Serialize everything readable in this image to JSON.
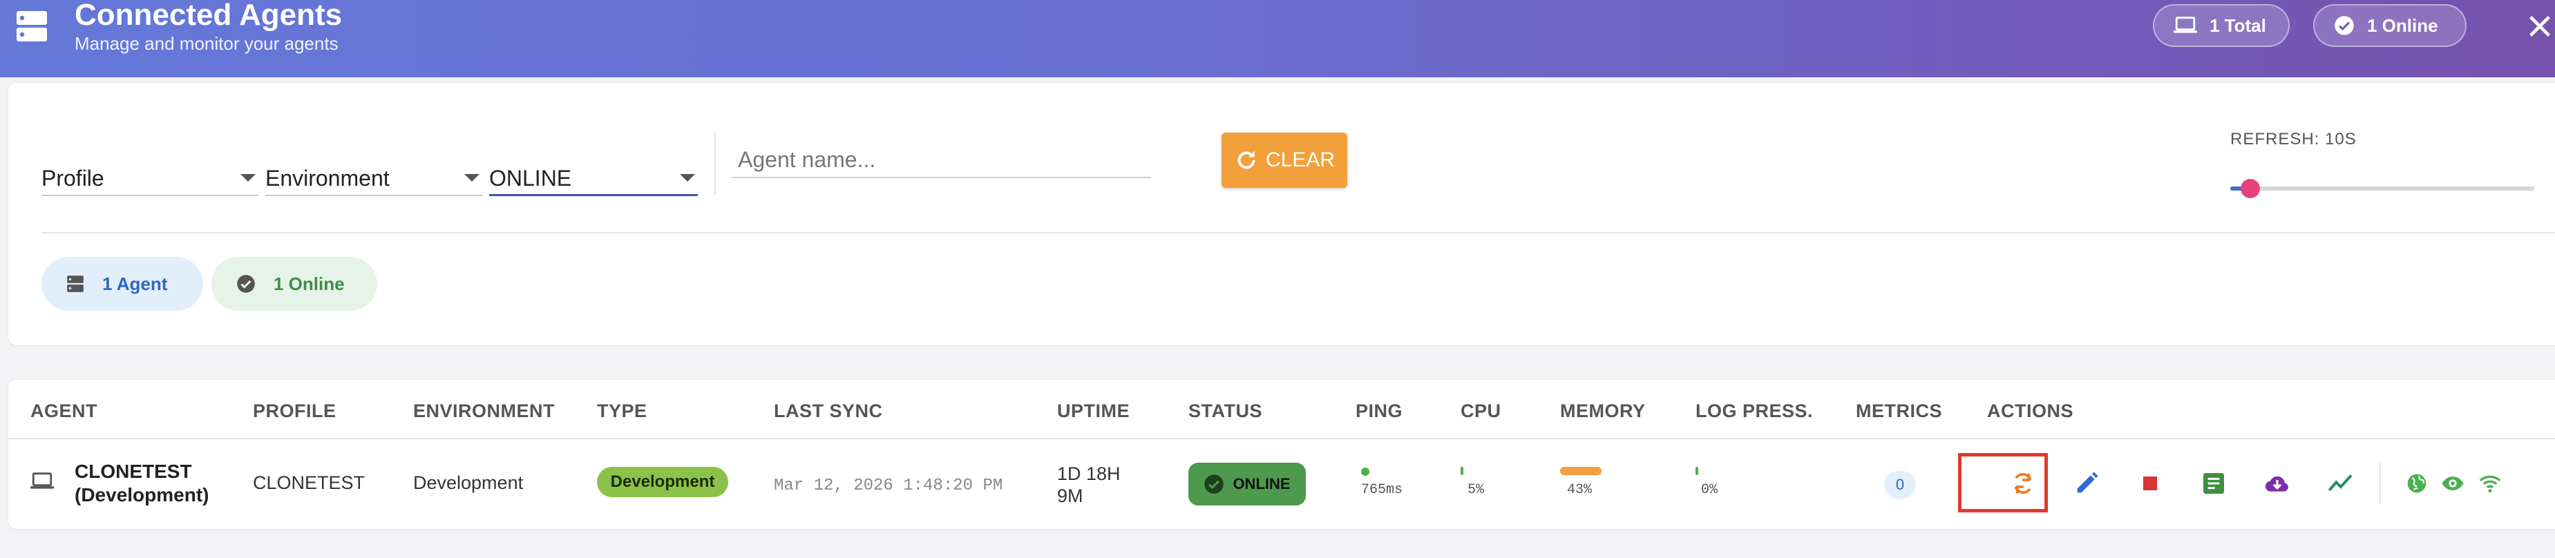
{
  "header": {
    "title": "Connected Agents",
    "subtitle": "Manage and monitor your agents",
    "total_chip": "1 Total",
    "online_chip": "1 Online"
  },
  "filters": {
    "profile_label": "Profile",
    "environment_label": "Environment",
    "status_value": "ONLINE",
    "agent_name_placeholder": "Agent name...",
    "clear_label": "CLEAR",
    "refresh_label": "REFRESH: 10S",
    "refresh_slider_fraction": 0.065,
    "agents_pill": "1 Agent",
    "online_pill": "1 Online"
  },
  "table": {
    "columns": [
      "AGENT",
      "PROFILE",
      "ENVIRONMENT",
      "TYPE",
      "LAST SYNC",
      "UPTIME",
      "STATUS",
      "PING",
      "CPU",
      "MEMORY",
      "LOG PRESS.",
      "METRICS",
      "ACTIONS"
    ],
    "row": {
      "agent_line1": "CLONETEST",
      "agent_line2": "(Development)",
      "profile": "CLONETEST",
      "environment": "Development",
      "type": "Development",
      "last_sync": "Mar 12, 2026 1:48:20 PM",
      "uptime_line1": "1D 18H",
      "uptime_line2": "9M",
      "status": "ONLINE",
      "ping": "765ms",
      "cpu": "5%",
      "cpu_fraction": 0.05,
      "memory": "43%",
      "memory_fraction": 0.43,
      "log_pressure": "0%",
      "log_pressure_fraction": 0.0,
      "metrics": "0"
    }
  },
  "colors": {
    "header_start": "#6478d8",
    "header_end": "#7651ad",
    "accent_blue": "#3f51b5",
    "clear_orange": "#f2a03a",
    "online_green": "#4d9a4e",
    "type_green": "#8bc34a",
    "memory_orange": "#f0a040",
    "slider_pink": "#e8407a",
    "highlight_red": "#e0392b"
  },
  "icons": {
    "app": "server-icon",
    "total": "laptop-icon",
    "online": "check-circle-icon",
    "close": "close-icon",
    "clear": "refresh-icon",
    "row_agent": "laptop-icon",
    "actions": [
      "sync-icon",
      "edit-icon",
      "stop-icon",
      "logs-icon",
      "cloud-download-icon",
      "trending-icon",
      "globe-icon",
      "eye-icon",
      "wifi-icon"
    ]
  }
}
